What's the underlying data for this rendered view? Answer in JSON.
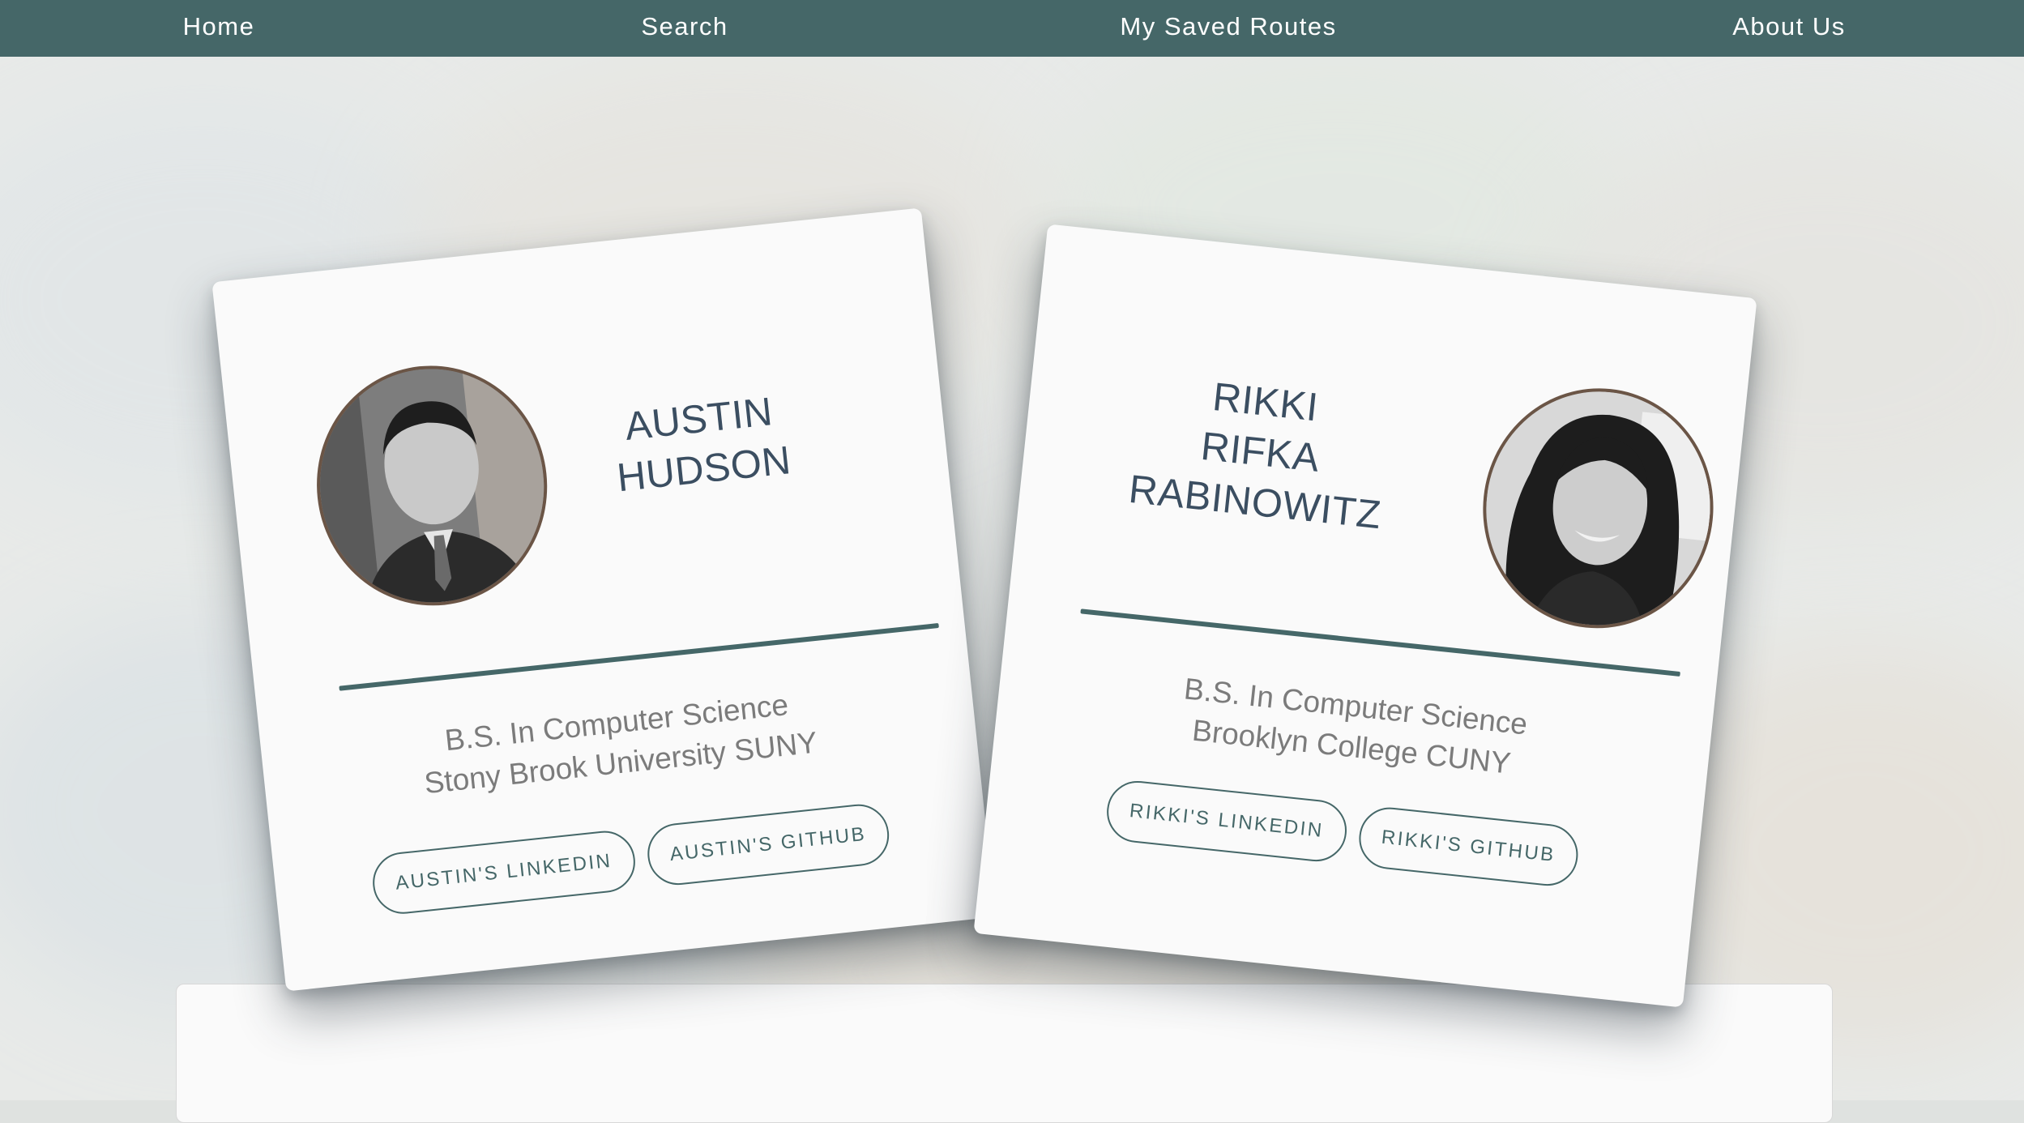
{
  "nav": {
    "items": [
      {
        "label": "Home"
      },
      {
        "label": "Search"
      },
      {
        "label": "My Saved Routes"
      },
      {
        "label": "About Us"
      }
    ]
  },
  "colors": {
    "accent": "#456768",
    "name_text": "#3b4e61",
    "avatar_border": "#6b5546"
  },
  "team": [
    {
      "first_name": "AUSTIN",
      "last_name": "HUDSON",
      "degree": "B.S. In Computer Science",
      "school": "Stony Brook University SUNY",
      "linkedin_label": "AUSTIN'S LINKEDIN",
      "github_label": "AUSTIN'S GITHUB"
    },
    {
      "first_name": "RIKKI",
      "middle_name": "RIFKA",
      "last_name": "RABINOWITZ",
      "degree": "B.S. In Computer Science",
      "school": "Brooklyn College CUNY",
      "linkedin_label": "RIKKI'S LINKEDIN",
      "github_label": "RIKKI'S GITHUB"
    }
  ]
}
